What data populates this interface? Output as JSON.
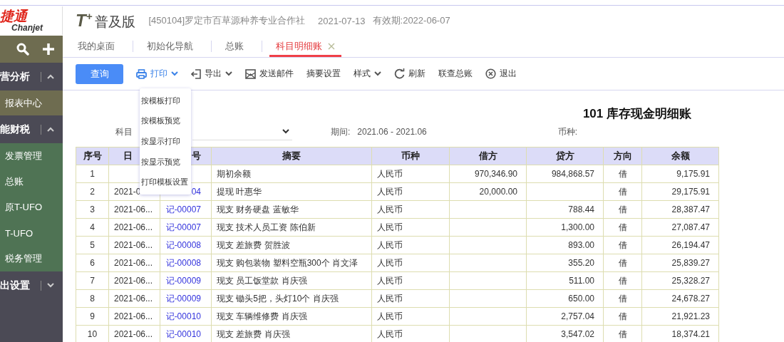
{
  "logo": {
    "text": "捷通",
    "subtitle": "Chanjet"
  },
  "product": {
    "name": "T",
    "mark": "+",
    "edition": "普及版"
  },
  "company": "[450104]罗定市百草源种养专业合作社",
  "date": "2021-07-13",
  "validity": "有效期:2022-06-07",
  "sidebar": {
    "items": [
      {
        "kind": "tools"
      },
      {
        "kind": "group",
        "label": "营分析",
        "expanded": true
      },
      {
        "kind": "link",
        "label": "报表中心"
      },
      {
        "kind": "group",
        "label": "能财税",
        "expanded": true
      },
      {
        "kind": "sub",
        "label": "发票管理"
      },
      {
        "kind": "sub",
        "label": "总账"
      },
      {
        "kind": "sub",
        "label": "原T-UFO"
      },
      {
        "kind": "sub",
        "label": "T-UFO"
      },
      {
        "kind": "sub",
        "label": "税务管理"
      },
      {
        "kind": "group",
        "label": "出设置",
        "expanded": false
      }
    ]
  },
  "tabs": [
    {
      "label": "我的桌面",
      "selected": false,
      "closable": false
    },
    {
      "label": "初始化导航",
      "selected": false,
      "closable": false
    },
    {
      "label": "总账",
      "selected": false,
      "closable": false
    },
    {
      "label": "科目明细账",
      "selected": true,
      "closable": true
    }
  ],
  "toolbar": [
    {
      "kind": "primary",
      "label": "查询"
    },
    {
      "kind": "menu",
      "label": "打印",
      "open": true
    },
    {
      "kind": "menu",
      "label": "导出",
      "open": false
    },
    {
      "kind": "button",
      "label": "发送邮件"
    },
    {
      "kind": "button",
      "label": "摘要设置"
    },
    {
      "kind": "menu",
      "label": "样式",
      "open": false
    },
    {
      "kind": "button",
      "label": "刷新"
    },
    {
      "kind": "button",
      "label": "联查总账"
    },
    {
      "kind": "button",
      "label": "退出"
    }
  ],
  "print_menu": [
    "按模板打印",
    "按模板预览",
    "按显示打印",
    "按显示预览",
    "打印模板设置"
  ],
  "report": {
    "title": "101 库存现金明细账",
    "subject_label": "科目",
    "period_label": "期间:",
    "period": "2021.06 - 2021.06",
    "currency_label": "币种:"
  },
  "table": {
    "columns": [
      "序号",
      "日",
      "号",
      "摘要",
      "币种",
      "借方",
      "贷方",
      "方向",
      "余额"
    ],
    "rows": [
      {
        "no": "1",
        "summary": "期初余额",
        "currency": "人民币",
        "debit": "970,346.90",
        "credit": "984,868.57",
        "direction": "借",
        "balance": "9,175.91"
      },
      {
        "no": "2",
        "date": "2021-0",
        "voucher": "04",
        "summary": "提现 叶惠华",
        "currency": "人民币",
        "debit": "20,000.00",
        "direction": "借",
        "balance": "29,175.91"
      },
      {
        "no": "3",
        "date": "2021-06...",
        "voucher": "记-00007",
        "summary": "现支 财务硬盘 蓝敏华",
        "currency": "人民币",
        "credit": "788.44",
        "direction": "借",
        "balance": "28,387.47"
      },
      {
        "no": "4",
        "date": "2021-06...",
        "voucher": "记-00007",
        "summary": "现支 技术人员工资 陈伯新",
        "currency": "人民币",
        "credit": "1,300.00",
        "direction": "借",
        "balance": "27,087.47"
      },
      {
        "no": "5",
        "date": "2021-06...",
        "voucher": "记-00008",
        "summary": "现支 差旅费 贺胜波",
        "currency": "人民币",
        "credit": "893.00",
        "direction": "借",
        "balance": "26,194.47"
      },
      {
        "no": "6",
        "date": "2021-06...",
        "voucher": "记-00008",
        "summary": "现支 购包装物 塑料空瓶300个 肖文泽",
        "currency": "人民币",
        "credit": "355.20",
        "direction": "借",
        "balance": "25,839.27"
      },
      {
        "no": "7",
        "date": "2021-06...",
        "voucher": "记-00009",
        "summary": "现支 员工饭堂款 肖庆强",
        "currency": "人民币",
        "credit": "511.00",
        "direction": "借",
        "balance": "25,328.27"
      },
      {
        "no": "8",
        "date": "2021-06...",
        "voucher": "记-00009",
        "summary": "现支 锄头5把，头灯10个 肖庆强",
        "currency": "人民币",
        "credit": "650.00",
        "direction": "借",
        "balance": "24,678.27"
      },
      {
        "no": "9",
        "date": "2021-06...",
        "voucher": "记-00010",
        "summary": "现支 车辆维修费 肖庆强",
        "currency": "人民币",
        "credit": "2,757.04",
        "direction": "借",
        "balance": "21,921.23"
      },
      {
        "no": "10",
        "date": "2021-06...",
        "voucher": "记-00010",
        "summary": "现支 差旅费 肖庆强",
        "currency": "人民币",
        "credit": "3,547.02",
        "direction": "借",
        "balance": "18,374.21"
      }
    ]
  }
}
